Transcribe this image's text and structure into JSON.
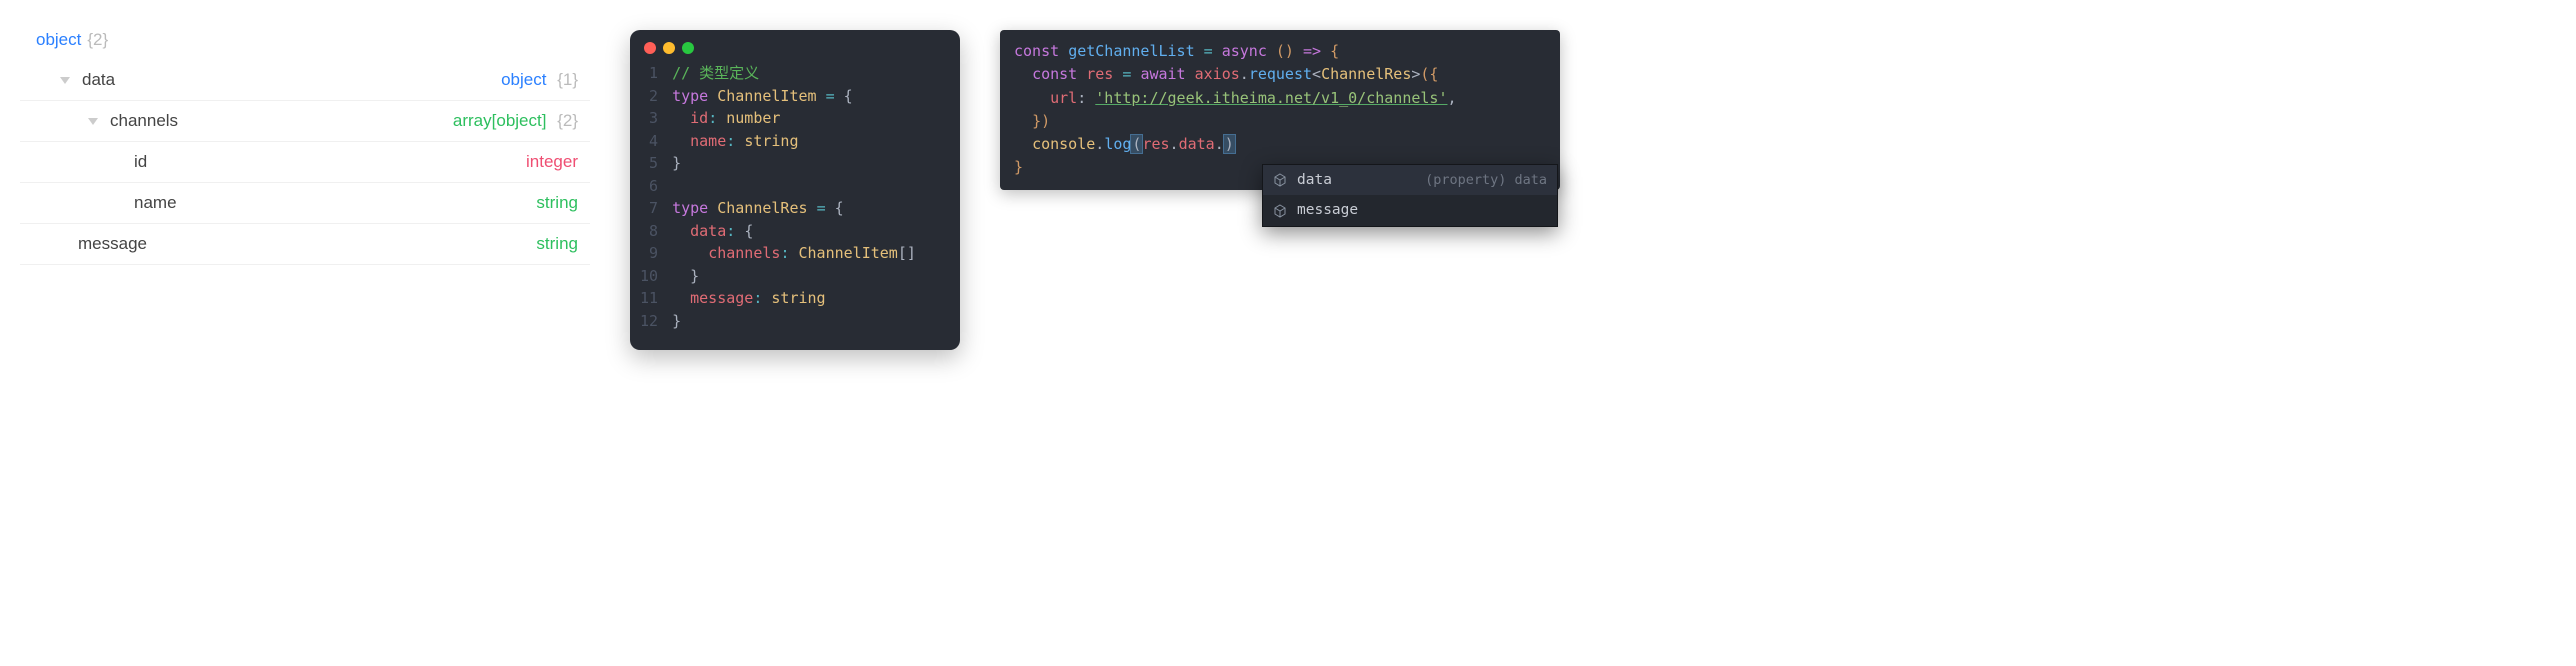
{
  "schema": {
    "root": {
      "key": "object",
      "count": "{2}"
    },
    "rows": [
      {
        "key": "data",
        "type": "object",
        "count": "{1}",
        "indent": 1,
        "caret": true
      },
      {
        "key": "channels",
        "type": "array[object]",
        "count": "{2}",
        "indent": 2,
        "caret": true,
        "typeClass": "arr"
      },
      {
        "key": "id",
        "type": "integer",
        "indent": 3,
        "typeClass": "int"
      },
      {
        "key": "name",
        "type": "string",
        "indent": 3,
        "typeClass": "str"
      },
      {
        "key": "message",
        "type": "string",
        "indent": 1,
        "typeClass": "str"
      }
    ]
  },
  "editor1": {
    "comment": "// 类型定义",
    "lines": [
      "type ChannelItem = {",
      "  id: number",
      "  name: string",
      "}",
      "",
      "type ChannelRes = {",
      "  data: {",
      "    channels: ChannelItem[]",
      "  }",
      "  message: string",
      "}"
    ],
    "tokens": {
      "type_kw": "type",
      "name1": "ChannelItem",
      "name2": "ChannelRes",
      "eq": "=",
      "id": "id",
      "number": "number",
      "name_prop": "name",
      "string": "string",
      "data_prop": "data",
      "channels_prop": "channels",
      "arr_suffix": "[]",
      "message_prop": "message"
    }
  },
  "editor2": {
    "fn": "getChannelList",
    "const_kw": "const",
    "async_kw": "async",
    "await_kw": "await",
    "res_var": "res",
    "axios": "axios",
    "request": "request",
    "generic": "ChannelRes",
    "url_prop": "url",
    "url_val": "'http://geek.itheima.net/v1_0/channels'",
    "console": "console",
    "log": "log",
    "data_prop": "data",
    "autocomplete": {
      "items": [
        {
          "label": "data",
          "hint": "(property) data"
        },
        {
          "label": "message",
          "hint": ""
        }
      ]
    }
  }
}
